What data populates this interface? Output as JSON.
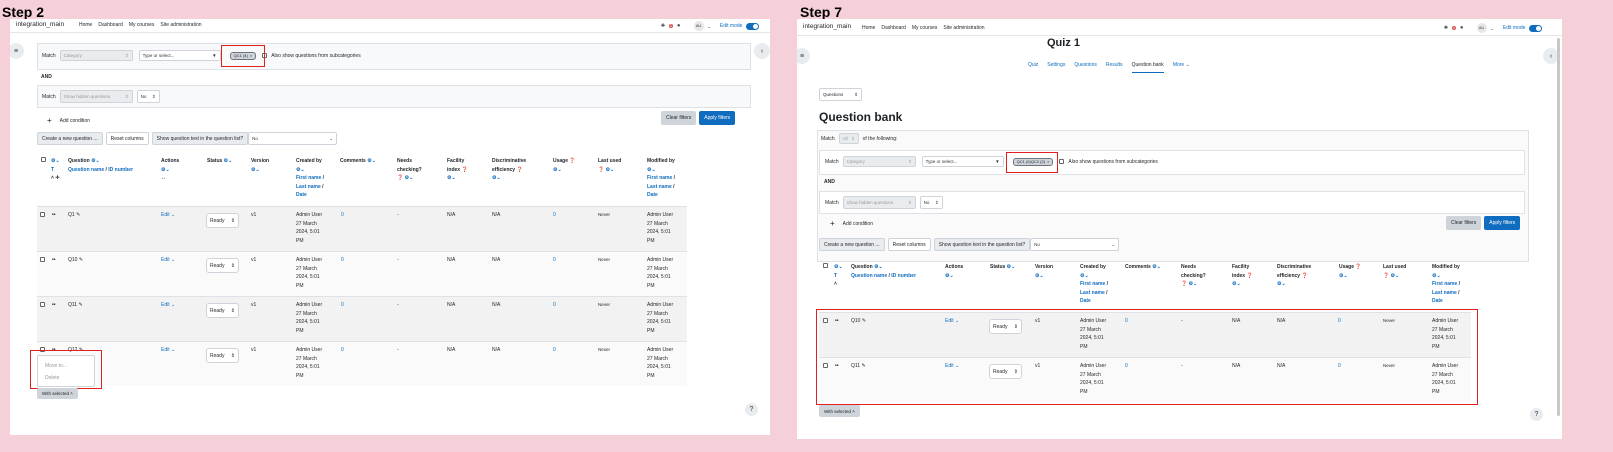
{
  "steps": [
    {
      "label": "Step 2",
      "nav": {
        "site": "integration_main",
        "links": [
          "Home",
          "Dashboard",
          "My courses",
          "Site administration"
        ],
        "notif_count": "1",
        "avatar": "AU",
        "edit_mode": "Edit mode"
      },
      "filter": {
        "match_label": "Match",
        "category_placeholder": "Category",
        "type_select": "Type or select...",
        "chip": "QC1 (4)",
        "chip_close": "×",
        "subcat": "Also show questions from subcategories",
        "and": "AND",
        "hidden_placeholder": "Show hidden questions",
        "hidden_value": "No",
        "add_condition": "Add condition",
        "clear": "Clear filters",
        "apply": "Apply filters"
      },
      "toolbar": {
        "create": "Create a new question ...",
        "reset": "Reset columns",
        "show_text": "Show question text in the question list?",
        "show_value": "No"
      },
      "headers": {
        "t": "T",
        "question": "Question",
        "question_sub": "Question name",
        "id_number": "ID number",
        "actions": "Actions",
        "status": "Status",
        "version": "Version",
        "created_by": "Created by",
        "first_name": "First name",
        "last_name": "Last name",
        "date": "Date",
        "comments": "Comments",
        "needs": "Needs",
        "checking": "checking?",
        "facility": "Facility",
        "index": "index",
        "discriminative": "Discriminative",
        "efficiency": "efficiency",
        "usage": "Usage",
        "last_used": "Last used",
        "modified_by": "Modified by"
      },
      "rows": [
        {
          "name": "Q1",
          "edit": "Edit",
          "status": "Ready",
          "version": "v1",
          "created": [
            "Admin User",
            "27 March",
            "2024, 5:01",
            "PM"
          ],
          "comments": "0",
          "needs": "-",
          "facility": "N/A",
          "disc": "N/A",
          "usage": "0",
          "last_used": "Never",
          "modified": [
            "Admin User",
            "27 March",
            "2024, 5:01",
            "PM"
          ]
        },
        {
          "name": "Q10",
          "edit": "Edit",
          "status": "Ready",
          "version": "v1",
          "created": [
            "Admin User",
            "27 March",
            "2024, 5:01",
            "PM"
          ],
          "comments": "0",
          "needs": "-",
          "facility": "N/A",
          "disc": "N/A",
          "usage": "0",
          "last_used": "Never",
          "modified": [
            "Admin User",
            "27 March",
            "2024, 5:01",
            "PM"
          ]
        },
        {
          "name": "Q11",
          "edit": "Edit",
          "status": "Ready",
          "version": "v1",
          "created": [
            "Admin User",
            "27 March",
            "2024, 5:01",
            "PM"
          ],
          "comments": "0",
          "needs": "-",
          "facility": "N/A",
          "disc": "N/A",
          "usage": "0",
          "last_used": "Never",
          "modified": [
            "Admin User",
            "27 March",
            "2024, 5:01",
            "PM"
          ]
        },
        {
          "name": "Q12",
          "edit": "Edit",
          "status": "Ready",
          "version": "v1",
          "created": [
            "Admin User",
            "27 March",
            "2024, 5:01",
            "PM"
          ],
          "comments": "0",
          "needs": "-",
          "facility": "N/A",
          "disc": "N/A",
          "usage": "0",
          "last_used": "Never",
          "modified": [
            "Admin User",
            "27 March",
            "2024, 5:01",
            "PM"
          ]
        }
      ],
      "popup": {
        "move": "Move to...",
        "delete": "Delete"
      },
      "with_selected": "With selected",
      "help": "?"
    },
    {
      "label": "Step 7",
      "nav": {
        "site": "integration_main",
        "links": [
          "Home",
          "Dashboard",
          "My courses",
          "Site administration"
        ],
        "notif_count": "1",
        "avatar": "AU",
        "edit_mode": "Edit mode"
      },
      "page_title": "Quiz 1",
      "tabs": [
        "Quiz",
        "Settings",
        "Questions",
        "Results",
        "Question bank",
        "More"
      ],
      "questions_select": "Questions",
      "heading": "Question bank",
      "match_all": {
        "match": "Match",
        "all": "All",
        "following": "of the following:"
      },
      "filter": {
        "match_label": "Match",
        "category_placeholder": "Category",
        "type_select": "Type or select...",
        "chip": "QC1 (0)QC2 (2)",
        "chip_close": "×",
        "subcat": "Also show questions from subcategories",
        "and": "AND",
        "hidden_placeholder": "Show hidden questions",
        "hidden_value": "No",
        "add_condition": "Add condition",
        "clear": "Clear filters",
        "apply": "Apply filters"
      },
      "toolbar": {
        "create": "Create a new question ...",
        "reset": "Reset columns",
        "show_text": "Show question text in the question list?",
        "show_value": "No"
      },
      "headers": {
        "t": "T",
        "question": "Question",
        "question_sub": "Question name",
        "id_number": "ID number",
        "actions": "Actions",
        "status": "Status",
        "version": "Version",
        "created_by": "Created by",
        "first_name": "First name",
        "last_name": "Last name",
        "date": "Date",
        "comments": "Comments",
        "needs": "Needs",
        "checking": "checking?",
        "facility": "Facility",
        "index": "index",
        "discriminative": "Discriminative",
        "efficiency": "efficiency",
        "usage": "Usage",
        "last_used": "Last used",
        "modified_by": "Modified by"
      },
      "rows": [
        {
          "name": "Q10",
          "edit": "Edit",
          "status": "Ready",
          "version": "v1",
          "created": [
            "Admin User",
            "27 March",
            "2024, 5:01",
            "PM"
          ],
          "comments": "0",
          "needs": "-",
          "facility": "N/A",
          "disc": "N/A",
          "usage": "0",
          "last_used": "Never",
          "modified": [
            "Admin User",
            "27 March",
            "2024, 5:01",
            "PM"
          ]
        },
        {
          "name": "Q11",
          "edit": "Edit",
          "status": "Ready",
          "version": "v1",
          "created": [
            "Admin User",
            "27 March",
            "2024, 5:01",
            "PM"
          ],
          "comments": "0",
          "needs": "-",
          "facility": "N/A",
          "disc": "N/A",
          "usage": "0",
          "last_used": "Never",
          "modified": [
            "Admin User",
            "27 March",
            "2024, 5:01",
            "PM"
          ]
        }
      ],
      "with_selected": "With selected",
      "help": "?"
    }
  ]
}
